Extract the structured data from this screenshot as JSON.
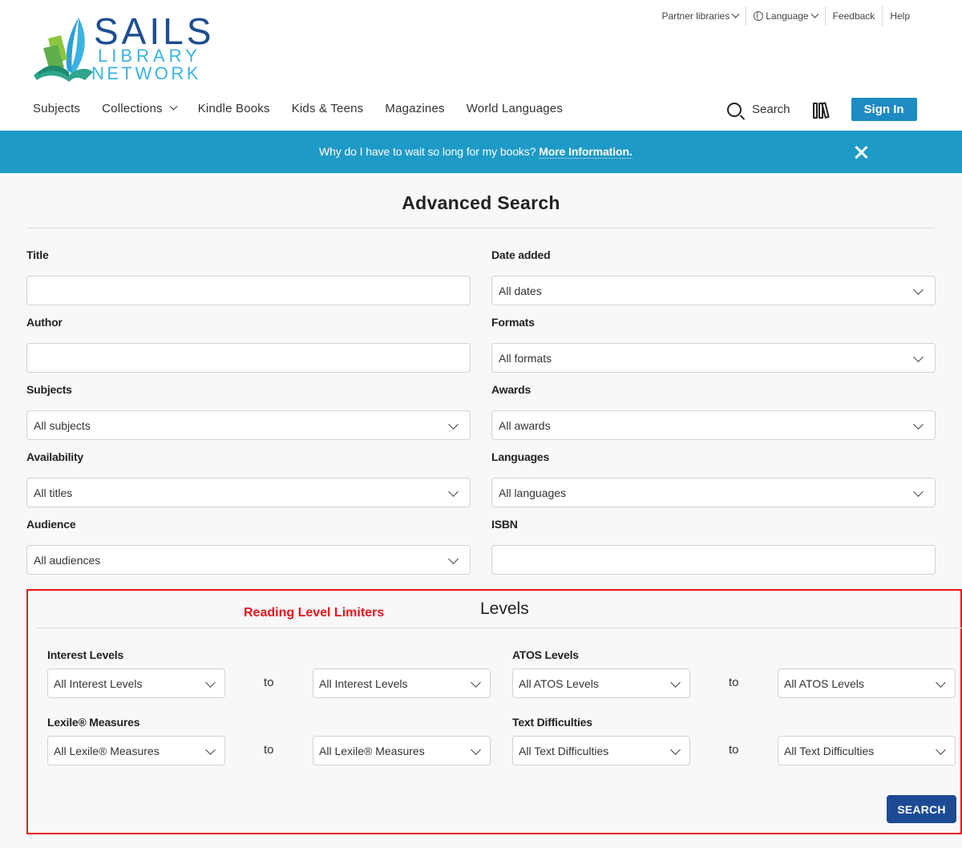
{
  "brand": {
    "name_line1": "SAILS",
    "name_line2": "LIBRARY",
    "name_line3": "NETWORK",
    "colors": {
      "navy": "#1d4e8f",
      "sky": "#3bb3e3",
      "green": "#8cc63f",
      "teal": "#2fa58d"
    }
  },
  "utility_nav": {
    "items": [
      {
        "label": "Partner libraries",
        "icon": "chevron-down-icon"
      },
      {
        "label": "Language",
        "icon": "globe-icon"
      },
      {
        "label": "Feedback"
      },
      {
        "label": "Help"
      }
    ]
  },
  "main_nav": {
    "items": [
      {
        "label": "Subjects"
      },
      {
        "label": "Collections",
        "icon": "chevron-down-icon"
      },
      {
        "label": "Kindle Books"
      },
      {
        "label": "Kids & Teens"
      },
      {
        "label": "Magazines"
      },
      {
        "label": "World Languages"
      }
    ],
    "search_label": "Search",
    "sign_in_label": "Sign In",
    "accent_color": "#1e8bc3"
  },
  "banner": {
    "text": "Why do I have to wait so long for my books?",
    "link_text": "More Information.",
    "close_icon": "close-icon",
    "color": "#1e9ac6"
  },
  "advanced_search": {
    "title": "Advanced Search",
    "fields": {
      "title": {
        "label": "Title",
        "value": ""
      },
      "author": {
        "label": "Author",
        "value": ""
      },
      "subjects": {
        "label": "Subjects",
        "value": "All subjects"
      },
      "availability": {
        "label": "Availability",
        "value": "All titles"
      },
      "audience": {
        "label": "Audience",
        "value": "All audiences"
      },
      "date_added": {
        "label": "Date added",
        "value": "All dates"
      },
      "formats": {
        "label": "Formats",
        "value": "All formats"
      },
      "awards": {
        "label": "Awards",
        "value": "All awards"
      },
      "languages": {
        "label": "Languages",
        "value": "All languages"
      },
      "isbn": {
        "label": "ISBN",
        "value": ""
      }
    }
  },
  "levels": {
    "annotation": "Reading Level Limiters",
    "annotation_color": "#e8141b",
    "title": "Levels",
    "to_label": "to",
    "interest": {
      "label": "Interest Levels",
      "from": "All Interest Levels",
      "to": "All Interest Levels"
    },
    "lexile": {
      "label": "Lexile® Measures",
      "from": "All Lexile® Measures",
      "to": "All Lexile® Measures"
    },
    "atos": {
      "label": "ATOS Levels",
      "from": "All ATOS Levels",
      "to": "All ATOS Levels"
    },
    "text_difficulty": {
      "label": "Text Difficulties",
      "from": "All Text Difficulties",
      "to": "All Text Difficulties"
    },
    "search_button": "SEARCH",
    "search_button_color": "#1d4b93"
  }
}
